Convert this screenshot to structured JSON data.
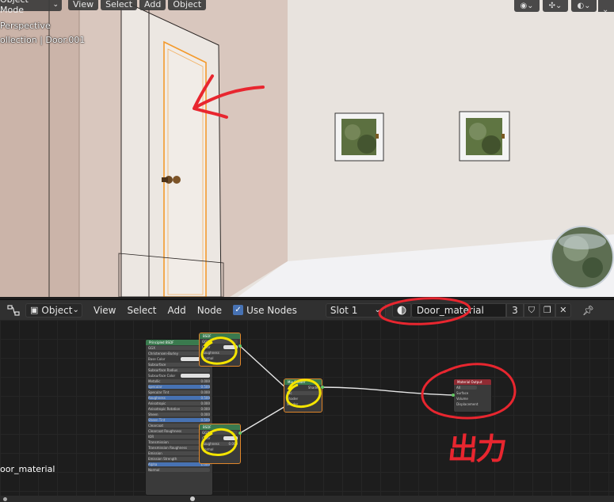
{
  "viewport": {
    "mode": "Object Mode",
    "menu": [
      "View",
      "Select",
      "Add",
      "Object"
    ],
    "info_line1": "Perspective",
    "info_line2": "ollection | Door.001"
  },
  "node_editor": {
    "editor_type": "Object",
    "menu": [
      "View",
      "Select",
      "Add",
      "Node"
    ],
    "use_nodes_label": "Use Nodes",
    "use_nodes_checked": true,
    "slot": "Slot 1",
    "material_name": "Door_material",
    "user_count": "3",
    "canvas_material_label": "oor_material"
  },
  "nodes": {
    "principled_title": "Principled BSDF",
    "principled_rows": [
      "GGX",
      "Christensen-Burley",
      "Base Color",
      "Subsurface",
      "Subsurface Radius",
      "Subsurface Color",
      "Metallic",
      "Specular",
      "Specular Tint",
      "Roughness",
      "Anisotropic",
      "Anisotropic Rotation",
      "Sheen",
      "Sheen Tint",
      "Clearcoat",
      "Clearcoat Roughness",
      "IOR",
      "Transmission",
      "Transmission Roughness",
      "Emission",
      "Emission Strength",
      "Alpha",
      "Normal"
    ],
    "principled_values": [
      "",
      "",
      "",
      "0.000",
      "",
      "",
      "0.000",
      "0.500",
      "0.000",
      "0.500",
      "0.000",
      "0.000",
      "0.000",
      "0.500",
      "0.000",
      "0.030",
      "1.450",
      "0.000",
      "0.000",
      "",
      "1.000",
      "1.000",
      ""
    ],
    "mix_title": "Mix Shader",
    "mix_rows": [
      "Shader",
      "Fac",
      "Shader",
      "Shader"
    ],
    "output_title": "Material Output",
    "output_target": "All",
    "output_rows": [
      "Surface",
      "Volume",
      "Displacement"
    ],
    "glossy_top_rows": [
      "BSDF",
      "GGX",
      "Color",
      "Roughness",
      "Normal"
    ],
    "glossy_bottom_rows": [
      "BSDF",
      "GGX",
      "Color",
      "Roughness",
      "Normal"
    ],
    "glossy_roughness_value": "0.000"
  },
  "annotation_text": "出力",
  "colors": {
    "selection_orange": "#e0862a",
    "accent_blue": "#4772b3",
    "annotation_red": "#e8262f",
    "annotation_yellow": "#f4e400",
    "shader_header": "#3a7a4e",
    "output_header": "#8f2b33"
  }
}
